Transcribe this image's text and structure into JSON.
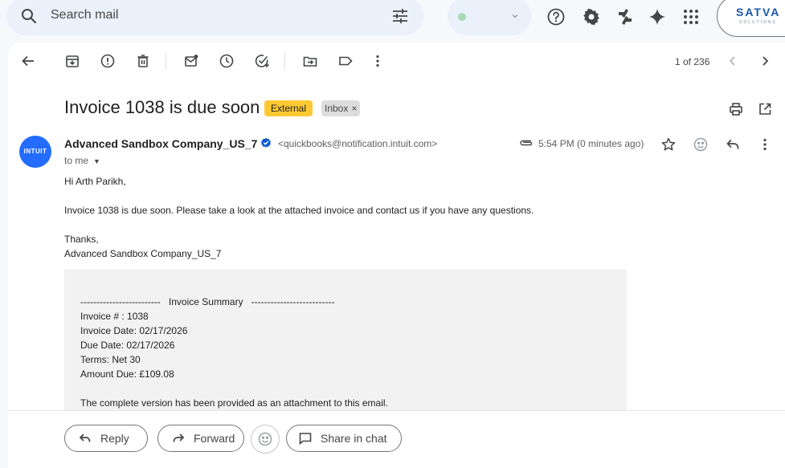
{
  "search": {
    "placeholder": "Search mail"
  },
  "brand": {
    "name": "SATVA",
    "subtitle": "SOLUTIONS"
  },
  "toolbar": {
    "pager": "1 of 236"
  },
  "email": {
    "subject": "Invoice 1038 is due soon",
    "labels": {
      "external": "External",
      "inbox": "Inbox",
      "remove": "×"
    },
    "avatar_text": "INTUIT",
    "sender_name": "Advanced Sandbox Company_US_7",
    "sender_email": "<quickbooks@notification.intuit.com>",
    "to": "to me",
    "time": "5:54 PM (0 minutes ago)",
    "greeting": "Hi Arth Parikh,",
    "message": "Invoice 1038 is due soon. Please take a look at the attached invoice and contact us if you have any questions.",
    "signoff": "Thanks,",
    "signature": "Advanced Sandbox Company_US_7",
    "summary": {
      "header": "-------------------------   Invoice Summary   --------------------------",
      "invoice_no": "Invoice # : 1038",
      "invoice_date": "Invoice Date: 02/17/2026",
      "due_date": "Due Date: 02/17/2026",
      "terms": "Terms: Net 30",
      "amount_due": "Amount Due: £109.08",
      "note": "The complete version has been provided as an attachment to this email."
    }
  },
  "actions": {
    "reply": "Reply",
    "forward": "Forward",
    "share": "Share in chat"
  },
  "colors": {
    "external_label": "#fcc934",
    "avatar": "#236cff",
    "status_dot": "#a8dab5",
    "verified": "#0b57d0"
  }
}
